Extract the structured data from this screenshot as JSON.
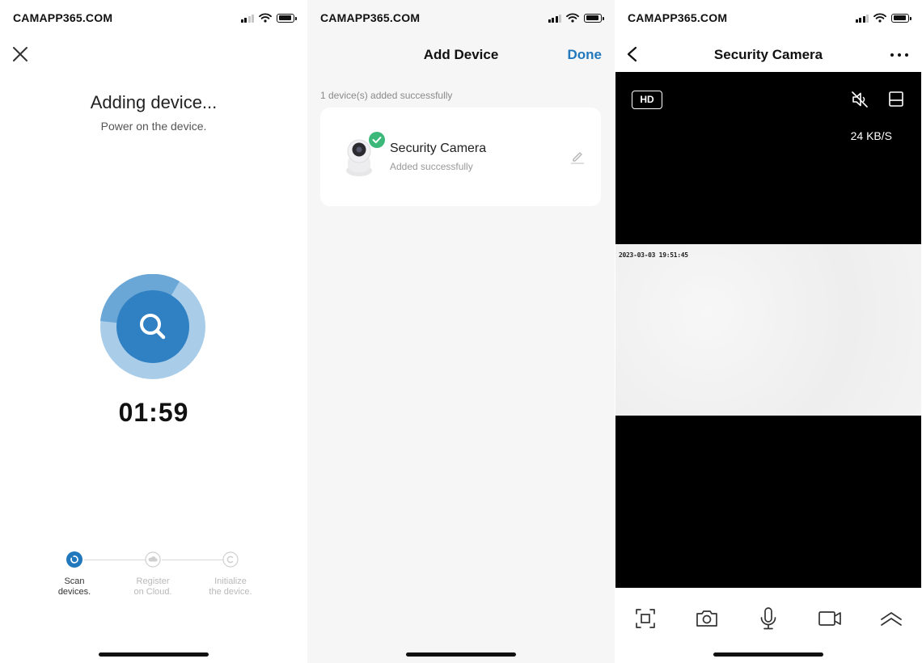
{
  "screens": [
    {
      "status": {
        "carrier": "CAMAPP365.COM"
      },
      "title": "Adding device...",
      "subtitle": "Power on the device.",
      "timer": "01:59",
      "steps": [
        {
          "line1": "Scan",
          "line2": "devices.",
          "state": "active"
        },
        {
          "line1": "Register",
          "line2": "on Cloud.",
          "state": "pending"
        },
        {
          "line1": "Initialize",
          "line2": "the device.",
          "state": "pending"
        }
      ]
    },
    {
      "status": {
        "carrier": "CAMAPP365.COM"
      },
      "title": "Add Device",
      "done_label": "Done",
      "added_note": "1 device(s) added successfully",
      "device": {
        "name": "Security Camera",
        "status": "Added successfully"
      }
    },
    {
      "status": {
        "carrier": "CAMAPP365.COM"
      },
      "title": "Security Camera",
      "hd_label": "HD",
      "rate": "24 KB/S",
      "timestamp": "2023-03-03 19:51:45"
    }
  ],
  "colors": {
    "accent": "#2278bd",
    "success": "#3cb97a",
    "scan_outer": "#9ec6e6",
    "scan_inner": "#2f81c3"
  },
  "icons": {
    "close": "close-icon",
    "search": "search-icon",
    "edit": "pencil-icon",
    "back": "chevron-left-icon",
    "more": "more-dots-icon",
    "mute": "speaker-muted-icon",
    "layout": "layout-icon",
    "screenshot": "screenshot-frame-icon",
    "camera": "camera-icon",
    "mic": "microphone-icon",
    "record": "video-record-icon",
    "expand": "chevrons-up-icon"
  }
}
